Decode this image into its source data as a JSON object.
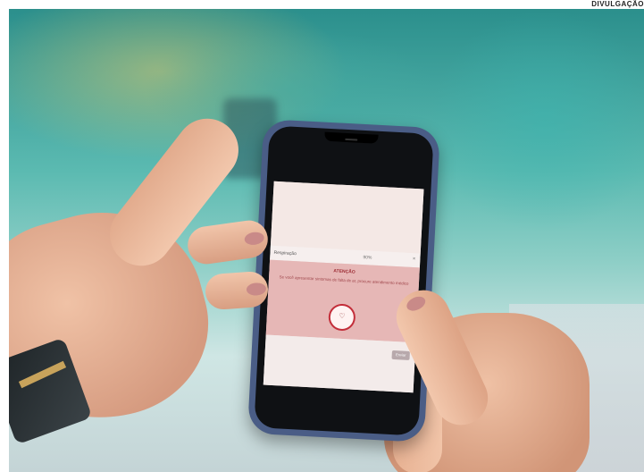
{
  "credit": "DIVULGAÇÃO",
  "phone_screen": {
    "bar_title": "Respiração",
    "bar_value": "90%",
    "bar_close": "×",
    "alert_title": "ATENÇÃO",
    "alert_text": "Se você apresentar sintomas de falta de ar, procure atendimento médico",
    "alert_icon_glyph": "♡",
    "button_label": "Enviar"
  },
  "colors": {
    "alert_background": "#e6b7b6",
    "alert_accent": "#c32e3a",
    "phone_case": "#4a5d86"
  },
  "icons": [
    "heart-monitor-icon",
    "close-icon"
  ]
}
